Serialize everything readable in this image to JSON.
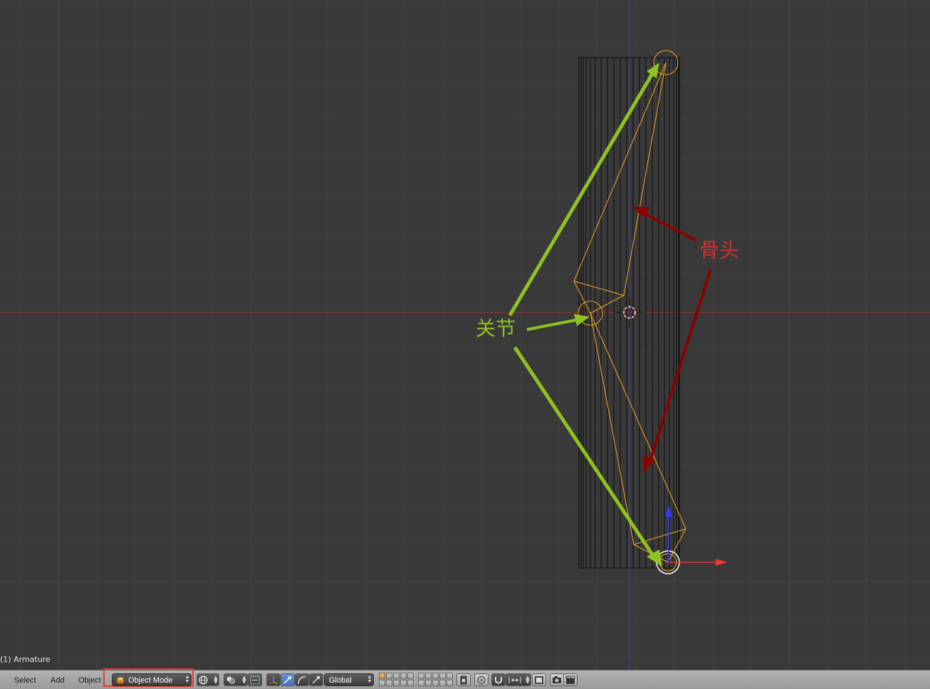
{
  "viewport": {
    "object_info": "(1) Armature",
    "annotations": {
      "joint_label": "关节",
      "bone_label": "骨头"
    },
    "colors": {
      "background": "#393939",
      "x_axis": "#b03030",
      "y_axis": "#2f3cc9",
      "wire": "#0d0d0d",
      "armature": "#f5a623",
      "joint_arrow": "#8fc31f",
      "bone_arrow": "#8b0000",
      "bone_label": "#d13232",
      "joint_label": "#8fc31f"
    }
  },
  "header": {
    "menus": {
      "select": "Select",
      "add": "Add",
      "object": "Object"
    },
    "mode": {
      "selected": "Object Mode",
      "icon": "object-cube-icon",
      "highlight_color": "#e53935"
    },
    "viewport_shading_icon": "globe-icon",
    "pivot_icon": "pivot-point-icon",
    "manipulator_icons": [
      "manipulator-toggle-icon",
      "translate-icon",
      "rotate-icon",
      "scale-icon"
    ],
    "transform_orientation": {
      "selected": "Global"
    },
    "layers_count": 20,
    "right_icons": [
      "lock-layer-icon",
      "proportional-edit-icon",
      "snap-magnet-icon",
      "snap-element-icon",
      "render-icon",
      "camera-icon",
      "clapperboard-icon"
    ]
  }
}
